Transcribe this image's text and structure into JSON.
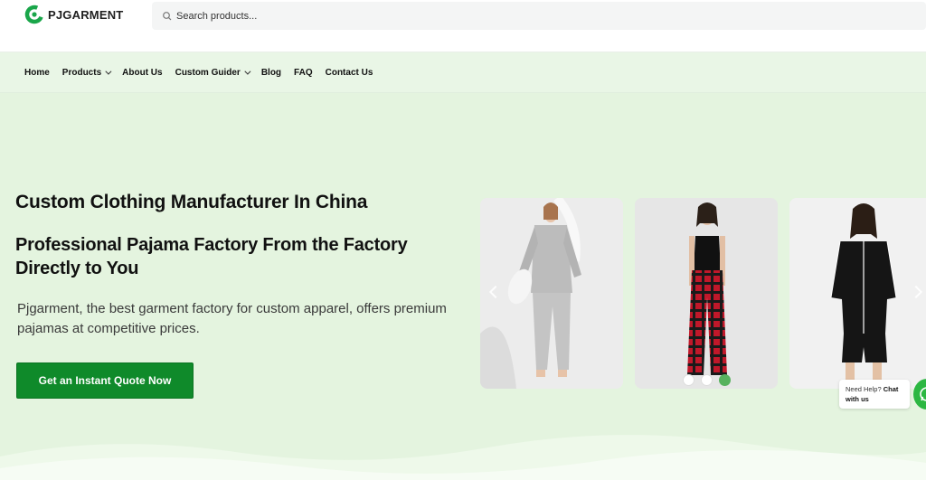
{
  "brand": {
    "name": "PJGARMENT",
    "color": "#1aa64a"
  },
  "search": {
    "placeholder": "Search products...",
    "icon": "search-icon"
  },
  "nav": {
    "items": [
      {
        "label": "Home",
        "dropdown": false
      },
      {
        "label": "Products",
        "dropdown": true
      },
      {
        "label": "About Us",
        "dropdown": false
      },
      {
        "label": "Custom Guider",
        "dropdown": true
      },
      {
        "label": "Blog",
        "dropdown": false
      },
      {
        "label": "FAQ",
        "dropdown": false
      },
      {
        "label": "Contact Us",
        "dropdown": false
      }
    ]
  },
  "hero": {
    "title": "Custom Clothing Manufacturer In China",
    "subtitle": "Professional Pajama Factory From the Factory Directly to You",
    "description": "Pjgarment, the best garment factory for custom apparel, offers premium pajamas at competitive prices.",
    "cta_label": "Get an Instant Quote Now",
    "cta_color": "#0f8a2a"
  },
  "carousel": {
    "slides": [
      "grey fleece pajama set",
      "black cami with red plaid pants",
      "black short pajama set with white piping"
    ],
    "dot_count": 3,
    "active_dot": 3,
    "active_color": "#57b25e"
  },
  "chat": {
    "prefix": "Need Help? ",
    "strong": "Chat with us"
  },
  "colors": {
    "background": "#e4f4df",
    "nav_background": "#e9f6e6"
  }
}
